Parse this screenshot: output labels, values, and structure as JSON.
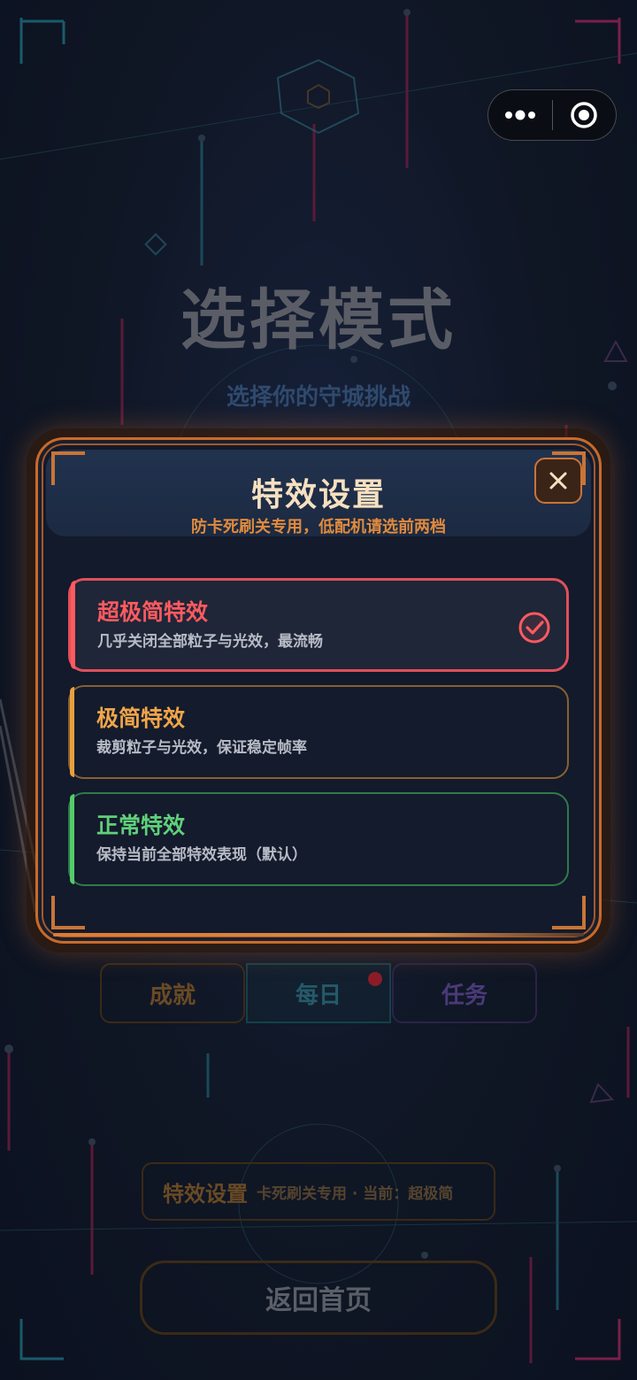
{
  "capsule": {
    "more_icon": "more-dots-icon",
    "target_icon": "target-icon"
  },
  "background": {
    "title": "选择模式",
    "subtitle": "选择你的守城挑战",
    "tabs": [
      {
        "label": "成就"
      },
      {
        "label": "每日"
      },
      {
        "label": "任务"
      }
    ],
    "fx_bar": {
      "label": "特效设置",
      "info": "卡死刷关专用 · 当前：超极简"
    },
    "home_button": "返回首页"
  },
  "modal": {
    "title": "特效设置",
    "subtitle": "防卡死刷关专用，低配机请选前两档",
    "close_icon": "close-icon",
    "options": [
      {
        "title": "超极简特效",
        "desc": "几乎关闭全部粒子与光效，最流畅",
        "selected": true,
        "color": "#ff5a5f"
      },
      {
        "title": "极简特效",
        "desc": "裁剪粒子与光效，保证稳定帧率",
        "selected": false,
        "color": "#f0a548"
      },
      {
        "title": "正常特效",
        "desc": "保持当前全部特效表现（默认）",
        "selected": false,
        "color": "#5fd07a"
      }
    ]
  }
}
